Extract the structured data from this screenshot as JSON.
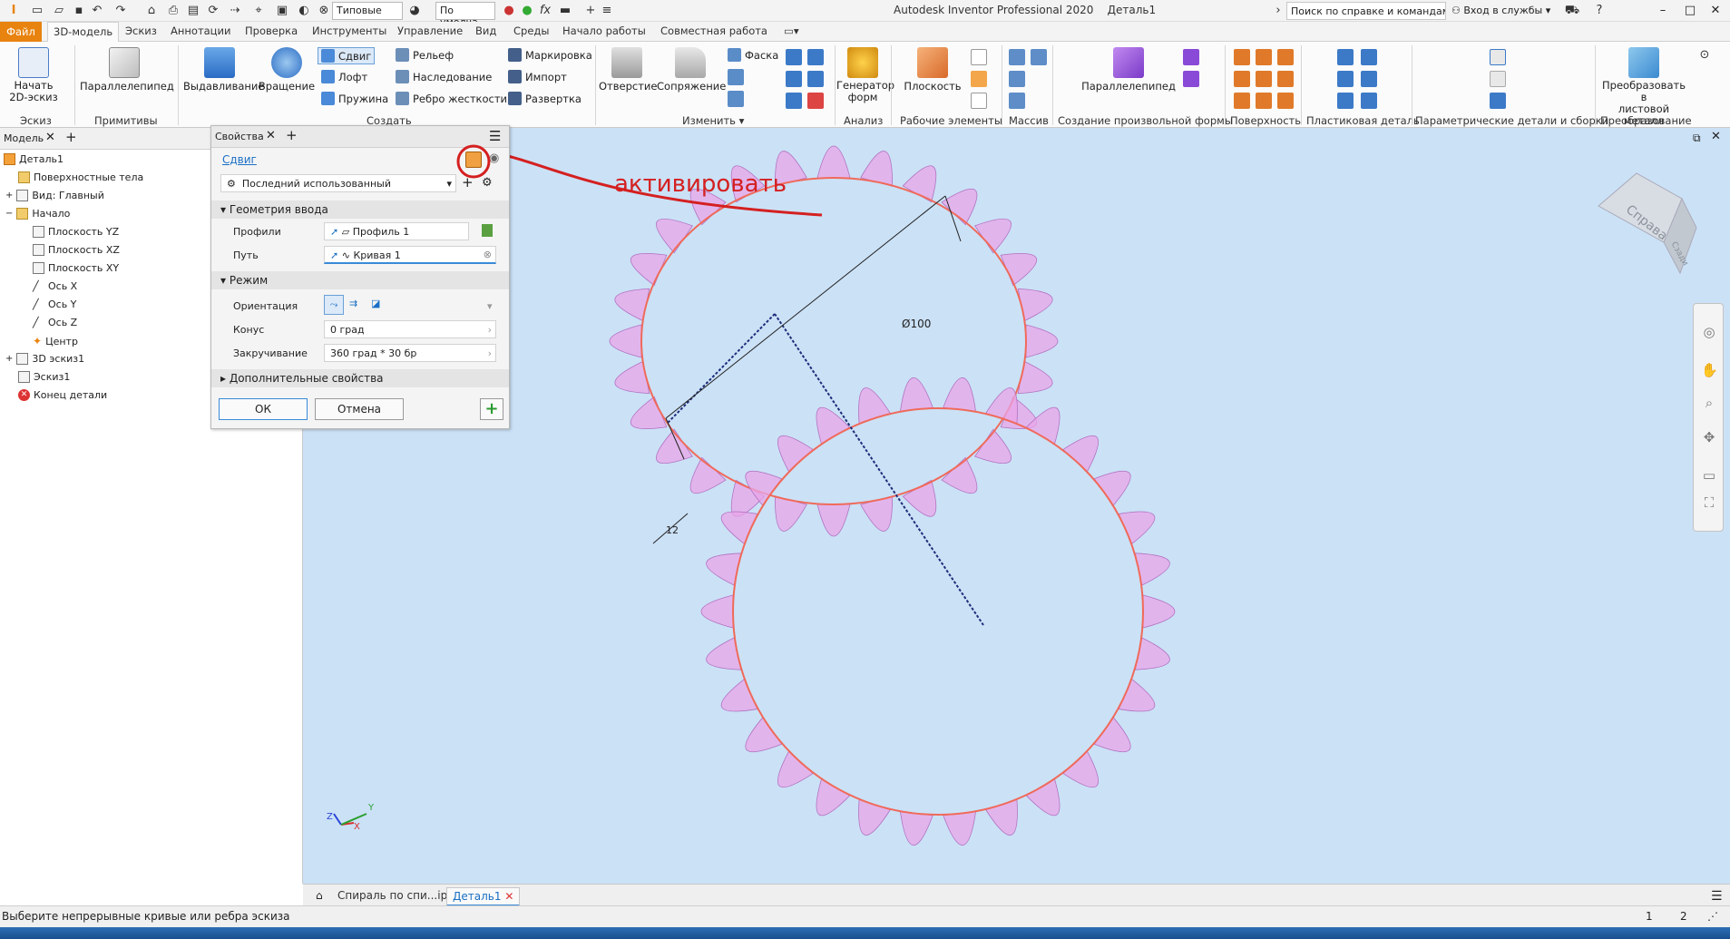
{
  "titlebar": {
    "app_title": "Autodesk Inventor Professional 2020",
    "doc_title": "Деталь1",
    "material_select": "Типовые",
    "appearance_select": "По умолча",
    "search_placeholder": "Поиск по справке и командам...",
    "signin": "Вход в службы",
    "help": "?"
  },
  "ribbon_tabs": [
    "Файл",
    "3D-модель",
    "Эскиз",
    "Аннотации",
    "Проверка",
    "Инструменты",
    "Управление",
    "Вид",
    "Среды",
    "Начало работы",
    "Совместная работа"
  ],
  "ribbon": {
    "sketch": {
      "start_label": "Начать\n2D-эскиз",
      "group": "Эскиз"
    },
    "primitives": {
      "box_label": "Параллелепипед",
      "group": "Примитивы"
    },
    "create": {
      "extrude": "Выдавливание",
      "revolve": "Вращение",
      "sweep": "Сдвиг",
      "loft": "Лофт",
      "coil": "Пружина",
      "emboss": "Рельеф",
      "derive": "Наследование",
      "rib": "Ребро жесткости",
      "mark": "Маркировка",
      "import": "Импорт",
      "unwrap": "Развертка",
      "group": "Создать"
    },
    "modify": {
      "hole": "Отверстие",
      "fillet": "Сопряжение",
      "chamfer": "Фаска",
      "group": "Изменить"
    },
    "explore": {
      "generator_label": "Генератор\nформ",
      "group": "Анализ"
    },
    "work_features": {
      "plane_label": "Плоскость",
      "group": "Рабочие элементы"
    },
    "pattern": {
      "group": "Массив"
    },
    "freeform": {
      "box_label": "Параллелепипед",
      "group": "Создание произвольной формы"
    },
    "surface": {
      "group": "Поверхность"
    },
    "plastic": {
      "group": "Пластиковая деталь"
    },
    "harness": {
      "group": "Параметрические детали и сборки"
    },
    "convert": {
      "label": "Преобразовать в\nлистовой металл",
      "group": "Преобразование"
    }
  },
  "browser": {
    "tab_label": "Модель",
    "items": [
      "Деталь1",
      "Поверхностные тела",
      "Вид: Главный",
      "Начало",
      "Плоскость YZ",
      "Плоскость XZ",
      "Плоскость XY",
      "Ось X",
      "Ось Y",
      "Ось Z",
      "Центр",
      "3D эскиз1",
      "Эскиз1",
      "Конец детали"
    ]
  },
  "properties": {
    "tab_label": "Свойства",
    "feature_name": "Сдвиг",
    "preset": "Последний использованный",
    "section_input": "Геометрия ввода",
    "profiles_label": "Профили",
    "profiles_value": "Профиль 1",
    "path_label": "Путь",
    "path_value": "Кривая 1",
    "section_mode": "Режим",
    "orientation_label": "Ориентация",
    "taper_label": "Конус",
    "taper_value": "0 град",
    "twist_label": "Закручивание",
    "twist_value": "360 град * 30 бр",
    "section_extra": "Дополнительные свойства",
    "ok": "ОК",
    "cancel": "Отмена"
  },
  "viewport": {
    "annotation": "активировать",
    "dim_diameter": "Ø100",
    "dim_twelve": "12",
    "viewcube_face": "Справа",
    "viewcube_side": "Сзади",
    "triad_x": "X",
    "triad_y": "Y",
    "triad_z": "Z",
    "annotation_color": "#d42020",
    "spiral_color": "#e8a6e8",
    "spiral_edge_color": "#f06a5a",
    "path_color": "#1e2d7a"
  },
  "doc_tabs": [
    "Спираль по спи...ipt",
    "Деталь1"
  ],
  "status": {
    "message": "Выберите непрерывные кривые или ребра эскиза",
    "count1": "1",
    "count2": "2"
  }
}
